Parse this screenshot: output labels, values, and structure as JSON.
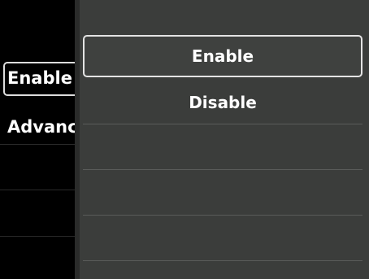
{
  "background_menu": {
    "items": [
      {
        "label": "Enable"
      },
      {
        "label": "Advanced"
      }
    ]
  },
  "popup": {
    "options": [
      {
        "label": "Enable"
      },
      {
        "label": "Disable"
      }
    ],
    "selected_index": 0
  }
}
